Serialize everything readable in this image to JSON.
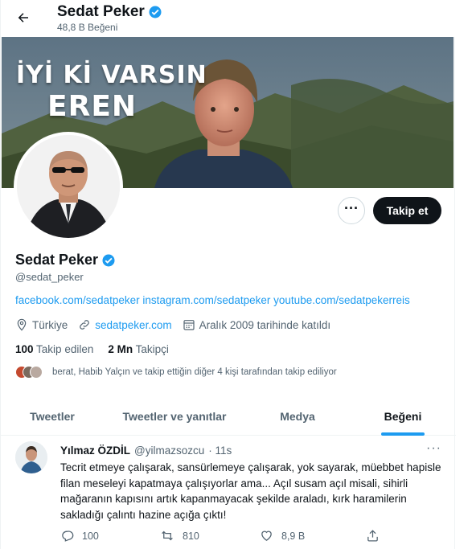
{
  "header": {
    "title": "Sedat Peker",
    "subtitle": "48,8 B Beğeni"
  },
  "banner": {
    "line1": "İYİ Kİ VARSIN",
    "line2": "EREN"
  },
  "profile": {
    "name": "Sedat Peker",
    "handle": "@sedat_peker",
    "bio": "facebook.com/sedatpeker instagram.com/sedatpeker youtube.com/sedatpekerreis",
    "location": "Türkiye",
    "website": "sedatpeker.com",
    "joined": "Aralık 2009 tarihinde katıldı",
    "following_count": "100",
    "following_label": "Takip edilen",
    "followers_count": "2 Mn",
    "followers_label": "Takipçi",
    "followed_by": "berat, Habib Yalçın ve takip ettiğin diğer 4 kişi tarafından takip ediliyor"
  },
  "actions": {
    "more": "···",
    "follow": "Takip et"
  },
  "tabs": [
    {
      "label": "Tweetler"
    },
    {
      "label": "Tweetler ve yanıtlar"
    },
    {
      "label": "Medya"
    },
    {
      "label": "Beğeni"
    }
  ],
  "tweet": {
    "author": "Yılmaz ÖZDİL",
    "handle": "@yilmazsozcu",
    "time": "· 11s",
    "more": "···",
    "text": "Tecrit etmeye çalışarak, sansürlemeye çalışarak, yok sayarak, müebbet hapisle filan meseleyi kapatmaya çalışıyorlar ama... Açıl susam açıl misali, sihirli mağaranın kapısını artık kapanmayacak şekilde araladı, kırk haramilerin sakladığı çalıntı hazine açığa çıktı!",
    "replies": "100",
    "retweets": "810",
    "likes": "8,9 B"
  },
  "colors": {
    "accent": "#1d9bf0",
    "text": "#0f1419",
    "secondary": "#536471",
    "follow_button": "#0f1419"
  }
}
